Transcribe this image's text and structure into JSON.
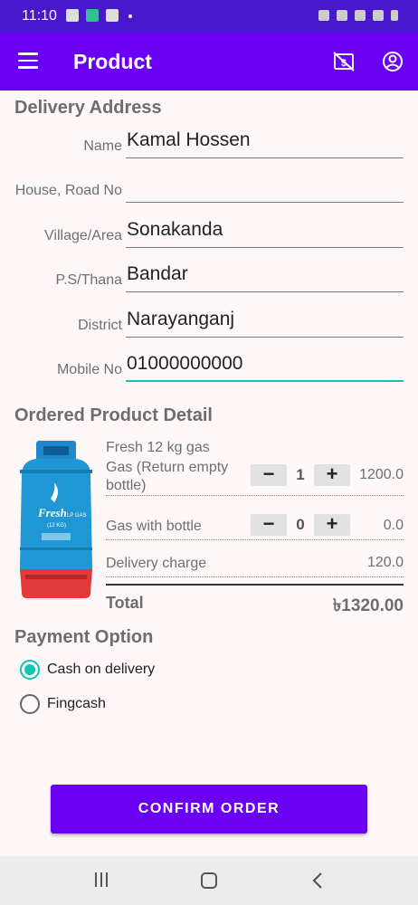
{
  "status_bar": {
    "time": "11:10"
  },
  "app_bar": {
    "title": "Product"
  },
  "delivery_address": {
    "heading": "Delivery Address",
    "fields": [
      {
        "label": "Name",
        "value": "Kamal Hossen"
      },
      {
        "label": "House, Road No",
        "value": ""
      },
      {
        "label": "Village/Area",
        "value": "Sonakanda"
      },
      {
        "label": "P.S/Thana",
        "value": "Bandar"
      },
      {
        "label": "District",
        "value": "Narayanganj"
      },
      {
        "label": "Mobile No",
        "value": "01000000000"
      }
    ]
  },
  "product_detail": {
    "heading": "Ordered Product Detail",
    "product_name": "Fresh 12 kg gas",
    "items": [
      {
        "label": "Gas (Return empty bottle)",
        "quantity": "1",
        "price": "1200.0"
      },
      {
        "label": "Gas with bottle",
        "quantity": "0",
        "price": "0.0"
      }
    ],
    "delivery_label": "Delivery charge",
    "delivery_charge": "120.0",
    "total_label": "Total",
    "total_value": "৳1320.00",
    "image_text": {
      "brand": "Fresh",
      "lp": "LP GAS",
      "size": "(12 KG)"
    }
  },
  "payment": {
    "heading": "Payment Option",
    "options": [
      {
        "label": "Cash on delivery",
        "selected": true
      },
      {
        "label": "Fingcash",
        "selected": false
      }
    ]
  },
  "confirm_button": "CONFIRM ORDER",
  "colors": {
    "appbar": "#6a00f4",
    "accent": "#12c4b5",
    "statusbar": "#4a18cc"
  }
}
